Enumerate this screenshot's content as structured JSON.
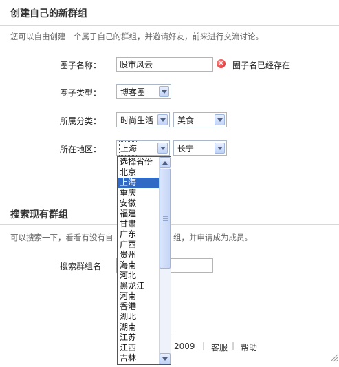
{
  "create_group": {
    "title": "创建自己的新群组",
    "description": "您可以自由创建一个属于自己的群组，并邀请好友，前来进行交流讨论。",
    "name_label": "圈子名称：",
    "name_value": "股市风云",
    "name_error": "圈子名已经存在",
    "type_label": "圈子类型：",
    "type_value": "博客圈",
    "category_label": "所属分类：",
    "category_primary": "时尚生活",
    "category_secondary": "美食",
    "region_label": "所在地区：",
    "province_value": "上海",
    "city_value": "长宁"
  },
  "province_dropdown": {
    "options": [
      "选择省份",
      "北京",
      "上海",
      "重庆",
      "安徽",
      "福建",
      "甘肃",
      "广东",
      "广西",
      "贵州",
      "海南",
      "河北",
      "黑龙江",
      "河南",
      "香港",
      "湖北",
      "湖南",
      "江苏",
      "江西",
      "吉林"
    ],
    "selected_index": 2
  },
  "search_group": {
    "title": "搜索现有群组",
    "description_left": "可以搜索一下，看看有没有自",
    "description_right": "组，并申请成为成员。",
    "search_label": "搜索群组名",
    "search_value": ""
  },
  "footer": {
    "year": "2009",
    "links": [
      "客服",
      "帮助"
    ]
  },
  "colors": {
    "selected_bg": "#316ac5",
    "error_red": "#d52020",
    "input_border": "#a9b7c9"
  },
  "icons": {
    "error": "error-x-icon",
    "dropdown": "chevron-down-icon"
  }
}
